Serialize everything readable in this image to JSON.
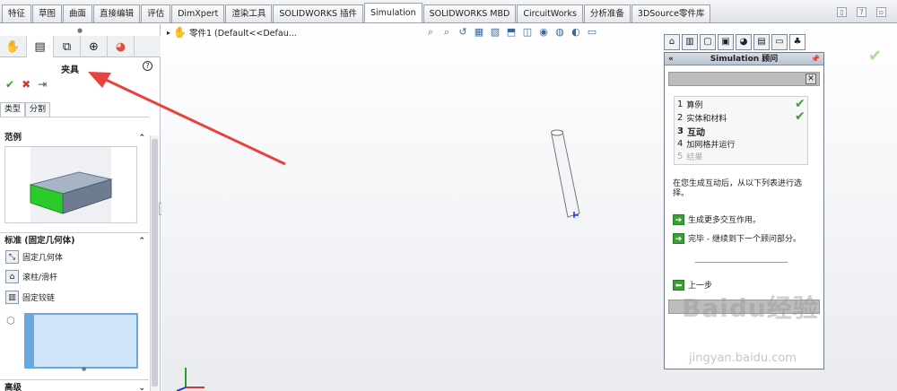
{
  "tabs": [
    "特征",
    "草图",
    "曲面",
    "直接编辑",
    "评估",
    "DimXpert",
    "渲染工具",
    "SOLIDWORKS 插件",
    "Simulation",
    "SOLIDWORKS MBD",
    "CircuitWorks",
    "分析准备",
    "3DSource零件库"
  ],
  "active_tab": "Simulation",
  "property_manager": {
    "title": "夹具",
    "help": "?",
    "ok": "✔",
    "cancel": "✖",
    "pin": "⇥",
    "subtabs": [
      "类型",
      "分割"
    ],
    "example_header": "范例",
    "standard_header": "标准 (固定几何体)",
    "options": [
      "固定几何体",
      "滚柱/滑杆",
      "固定铰链"
    ],
    "advanced_header": "高级"
  },
  "tree_root": "零件1  (Default<<Defau...",
  "advisor": {
    "title": "Simulation 顾问",
    "collapse": "«",
    "pin": "📌",
    "steps": [
      {
        "num": "1",
        "label": "算例"
      },
      {
        "num": "2",
        "label": "实体和材料"
      },
      {
        "num": "3",
        "label": "互动"
      },
      {
        "num": "4",
        "label": "加网格并运行"
      },
      {
        "num": "5",
        "label": "结果"
      }
    ],
    "description": "在您生成互动后，从以下列表进行选择。",
    "links": [
      "生成更多交互作用。",
      "完毕 - 继续到下一个顾问部分。"
    ],
    "back": "上一步"
  },
  "watermark": {
    "main": "Baidu经验",
    "sub": "jingyan.baidu.com"
  },
  "colors": {
    "accent": "#3aa036",
    "arrow": "#e8423f",
    "selection": "#cfe4f8"
  }
}
